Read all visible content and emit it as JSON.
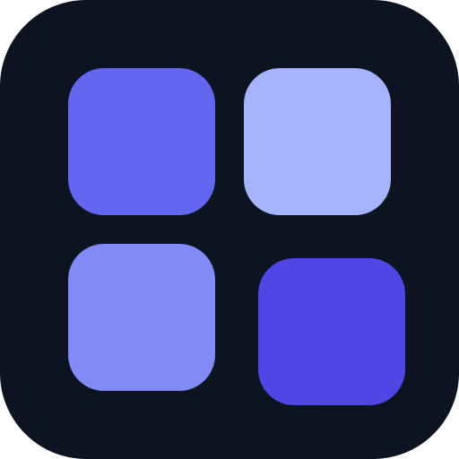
{
  "icon": {
    "name": "app-grid-icon",
    "background_color": "#0d1421",
    "tiles": [
      {
        "id": "tile-top-left",
        "color": "#6366f1"
      },
      {
        "id": "tile-top-right",
        "color": "#a5b4fc"
      },
      {
        "id": "tile-bottom-left",
        "color": "#818cf8"
      },
      {
        "id": "tile-bottom-right",
        "color": "#4f46e5"
      }
    ]
  }
}
